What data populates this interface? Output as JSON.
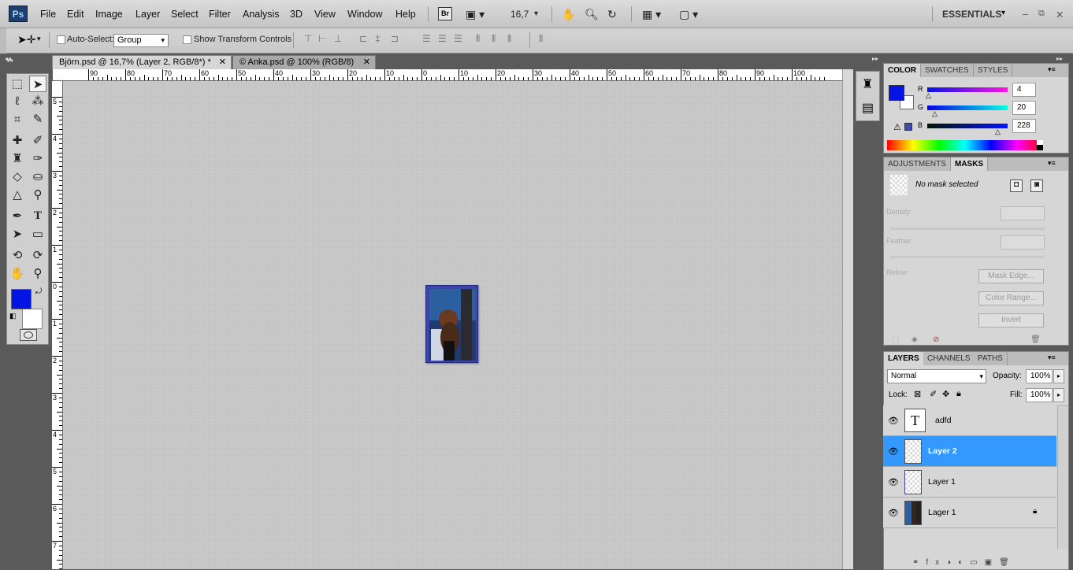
{
  "app": {
    "logo": "Ps"
  },
  "menu": {
    "items": [
      "File",
      "Edit",
      "Image",
      "Layer",
      "Select",
      "Filter",
      "Analysis",
      "3D",
      "View",
      "Window",
      "Help"
    ],
    "bridge": "Br",
    "zoom": "16,7",
    "workspace": "ESSENTIALS"
  },
  "options": {
    "auto_select_label": "Auto-Select:",
    "auto_select_value": "Group",
    "show_transform_label": "Show Transform Controls"
  },
  "doc_tabs": [
    {
      "label": "Björn.psd @ 16,7% (Layer 2, RGB/8*) *",
      "active": true
    },
    {
      "label": "© Anka.psd @ 100% (RGB/8)",
      "active": false
    }
  ],
  "ruler": {
    "h_labels": [
      "90",
      "80",
      "70",
      "60",
      "50",
      "40",
      "30",
      "20",
      "10",
      "0",
      "10",
      "20",
      "30",
      "40",
      "50",
      "60",
      "70",
      "80",
      "90",
      "100"
    ],
    "v_labels": [
      "5",
      "4",
      "3",
      "2",
      "1",
      "0",
      "1",
      "2",
      "3",
      "4",
      "5",
      "6",
      "7"
    ]
  },
  "color_panel": {
    "tabs": [
      "COLOR",
      "SWATCHES",
      "STYLES"
    ],
    "r_label": "R",
    "r_value": "4",
    "g_label": "G",
    "g_value": "20",
    "b_label": "B",
    "b_value": "228",
    "foreground": "#0414e4",
    "background": "#ffffff"
  },
  "masks_panel": {
    "tabs": [
      "ADJUSTMENTS",
      "MASKS"
    ],
    "status": "No mask selected",
    "density_label": "Density:",
    "feather_label": "Feather:",
    "refine_label": "Refine:",
    "mask_edge": "Mask Edge...",
    "color_range": "Color Range...",
    "invert": "Invert"
  },
  "layers_panel": {
    "tabs": [
      "LAYERS",
      "CHANNELS",
      "PATHS"
    ],
    "blend_mode": "Normal",
    "opacity_label": "Opacity:",
    "opacity_value": "100%",
    "lock_label": "Lock:",
    "fill_label": "Fill:",
    "fill_value": "100%",
    "layers": [
      {
        "name": "adfd",
        "type": "text",
        "selected": false
      },
      {
        "name": "Layer 2",
        "type": "pixel",
        "selected": true
      },
      {
        "name": "Layer 1",
        "type": "pixel",
        "selected": false
      },
      {
        "name": "Lager 1",
        "type": "image",
        "selected": false,
        "locked": true
      }
    ]
  },
  "colors": {
    "selection": "#3399ff",
    "canvas": "#c8c8c8",
    "ui": "#d6d6d6"
  }
}
